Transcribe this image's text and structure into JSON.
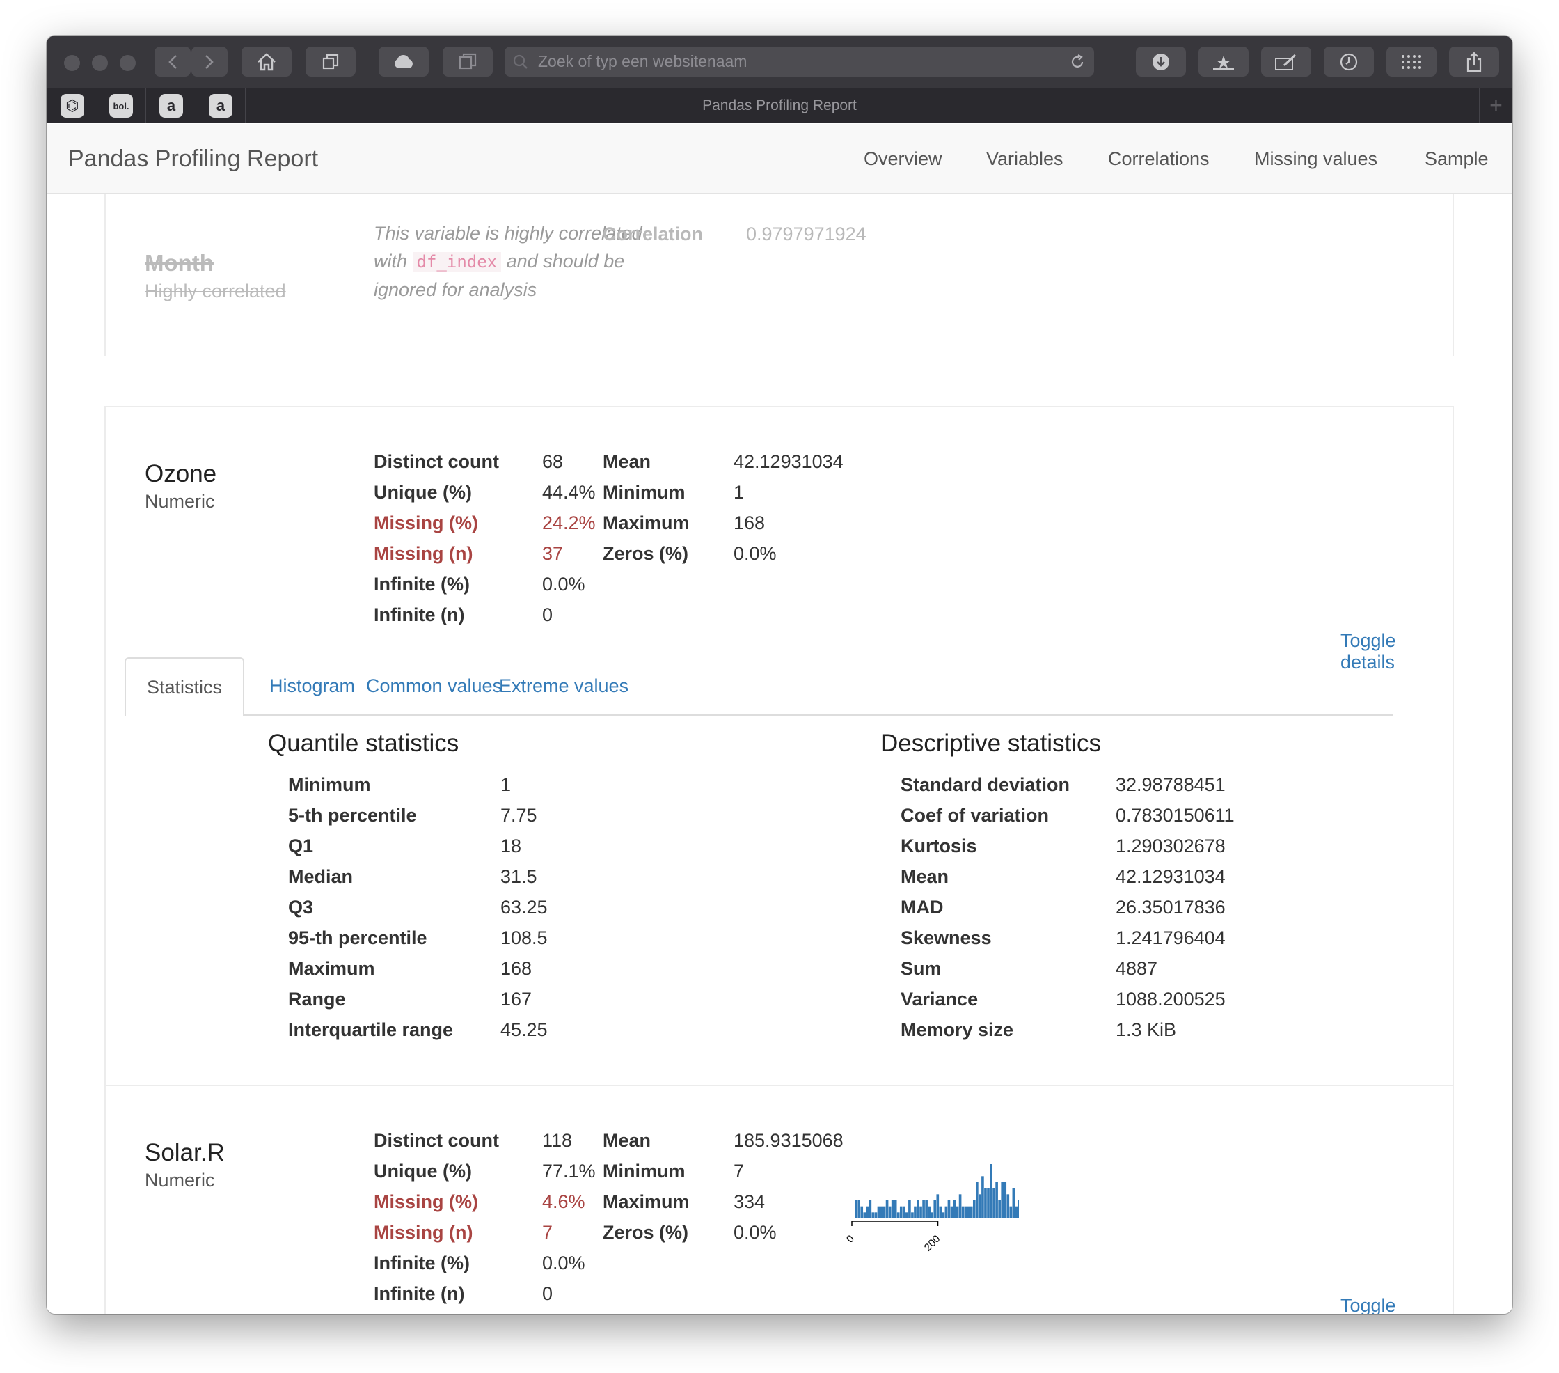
{
  "browser": {
    "address_placeholder": "Zoek of typ een websitenaam",
    "tab_title": "Pandas Profiling Report",
    "favorites": [
      {
        "icon": "github-icon",
        "glyph": "⌬"
      },
      {
        "icon": "bol-icon",
        "glyph": "bol."
      },
      {
        "icon": "amazon-icon",
        "glyph": "a"
      },
      {
        "icon": "amazon-icon",
        "glyph": "a"
      }
    ],
    "new_tab_glyph": "+"
  },
  "navbar": {
    "brand": "Pandas Profiling Report",
    "links": [
      "Overview",
      "Variables",
      "Correlations",
      "Missing values",
      "Sample"
    ]
  },
  "month": {
    "name": "Month",
    "type": "Highly correlated",
    "note_pre": "This variable is highly correlated with",
    "note_code": "df_index",
    "note_post": "and should be ignored for analysis",
    "corr_label": "Correlation",
    "corr_value": "0.9797971924"
  },
  "ozone": {
    "name": "Ozone",
    "type": "Numeric",
    "stats_left": [
      {
        "label": "Distinct count",
        "value": "68"
      },
      {
        "label": "Unique (%)",
        "value": "44.4%"
      },
      {
        "label": "Missing (%)",
        "value": "24.2%"
      },
      {
        "label": "Missing (n)",
        "value": "37"
      },
      {
        "label": "Infinite (%)",
        "value": "0.0%"
      },
      {
        "label": "Infinite (n)",
        "value": "0"
      }
    ],
    "stats_right": [
      {
        "label": "Mean",
        "value": "42.12931034"
      },
      {
        "label": "Minimum",
        "value": "1"
      },
      {
        "label": "Maximum",
        "value": "168"
      },
      {
        "label": "Zeros (%)",
        "value": "0.0%"
      }
    ],
    "toggle": "Toggle details",
    "tabs": [
      "Statistics",
      "Histogram",
      "Common values",
      "Extreme values"
    ],
    "quantile_title": "Quantile statistics",
    "quantile": [
      {
        "label": "Minimum",
        "value": "1"
      },
      {
        "label": "5-th percentile",
        "value": "7.75"
      },
      {
        "label": "Q1",
        "value": "18"
      },
      {
        "label": "Median",
        "value": "31.5"
      },
      {
        "label": "Q3",
        "value": "63.25"
      },
      {
        "label": "95-th percentile",
        "value": "108.5"
      },
      {
        "label": "Maximum",
        "value": "168"
      },
      {
        "label": "Range",
        "value": "167"
      },
      {
        "label": "Interquartile range",
        "value": "45.25"
      }
    ],
    "descriptive_title": "Descriptive statistics",
    "descriptive": [
      {
        "label": "Standard deviation",
        "value": "32.98788451"
      },
      {
        "label": "Coef of variation",
        "value": "0.7830150611"
      },
      {
        "label": "Kurtosis",
        "value": "1.290302678"
      },
      {
        "label": "Mean",
        "value": "42.12931034"
      },
      {
        "label": "MAD",
        "value": "26.35017836"
      },
      {
        "label": "Skewness",
        "value": "1.241796404"
      },
      {
        "label": "Sum",
        "value": "4887"
      },
      {
        "label": "Variance",
        "value": "1088.200525"
      },
      {
        "label": "Memory size",
        "value": "1.3 KiB"
      }
    ]
  },
  "solar": {
    "name": "Solar.R",
    "type": "Numeric",
    "stats_left": [
      {
        "label": "Distinct count",
        "value": "118"
      },
      {
        "label": "Unique (%)",
        "value": "77.1%"
      },
      {
        "label": "Missing (%)",
        "value": "4.6%"
      },
      {
        "label": "Missing (n)",
        "value": "7"
      },
      {
        "label": "Infinite (%)",
        "value": "0.0%"
      },
      {
        "label": "Infinite (n)",
        "value": "0"
      }
    ],
    "stats_right": [
      {
        "label": "Mean",
        "value": "185.9315068"
      },
      {
        "label": "Minimum",
        "value": "7"
      },
      {
        "label": "Maximum",
        "value": "334"
      },
      {
        "label": "Zeros (%)",
        "value": "0.0%"
      }
    ],
    "toggle": "Toggle details"
  },
  "chart_data": {
    "type": "bar",
    "title": "",
    "xlabel": "",
    "ylabel": "",
    "xlim": [
      0,
      340
    ],
    "x_ticks": [
      "0",
      "200"
    ],
    "x_tick_values": [
      0,
      200
    ],
    "bin_start": 7,
    "bin_width": 6.54,
    "values": [
      3,
      3,
      2,
      1,
      2,
      3,
      1,
      1,
      2,
      2,
      2,
      3,
      2,
      3,
      3,
      1,
      2,
      2,
      1,
      3,
      1,
      2,
      3,
      2,
      3,
      3,
      2,
      1,
      3,
      4,
      2,
      1,
      2,
      3,
      2,
      3,
      2,
      4,
      2,
      2,
      2,
      2,
      3,
      6,
      4,
      7,
      5,
      5,
      9,
      5,
      6,
      3,
      6,
      6,
      4,
      2,
      5,
      2,
      3,
      3
    ]
  },
  "colors": {
    "bar": "#337ab7",
    "link": "#337ab7",
    "alert": "#a94442"
  }
}
